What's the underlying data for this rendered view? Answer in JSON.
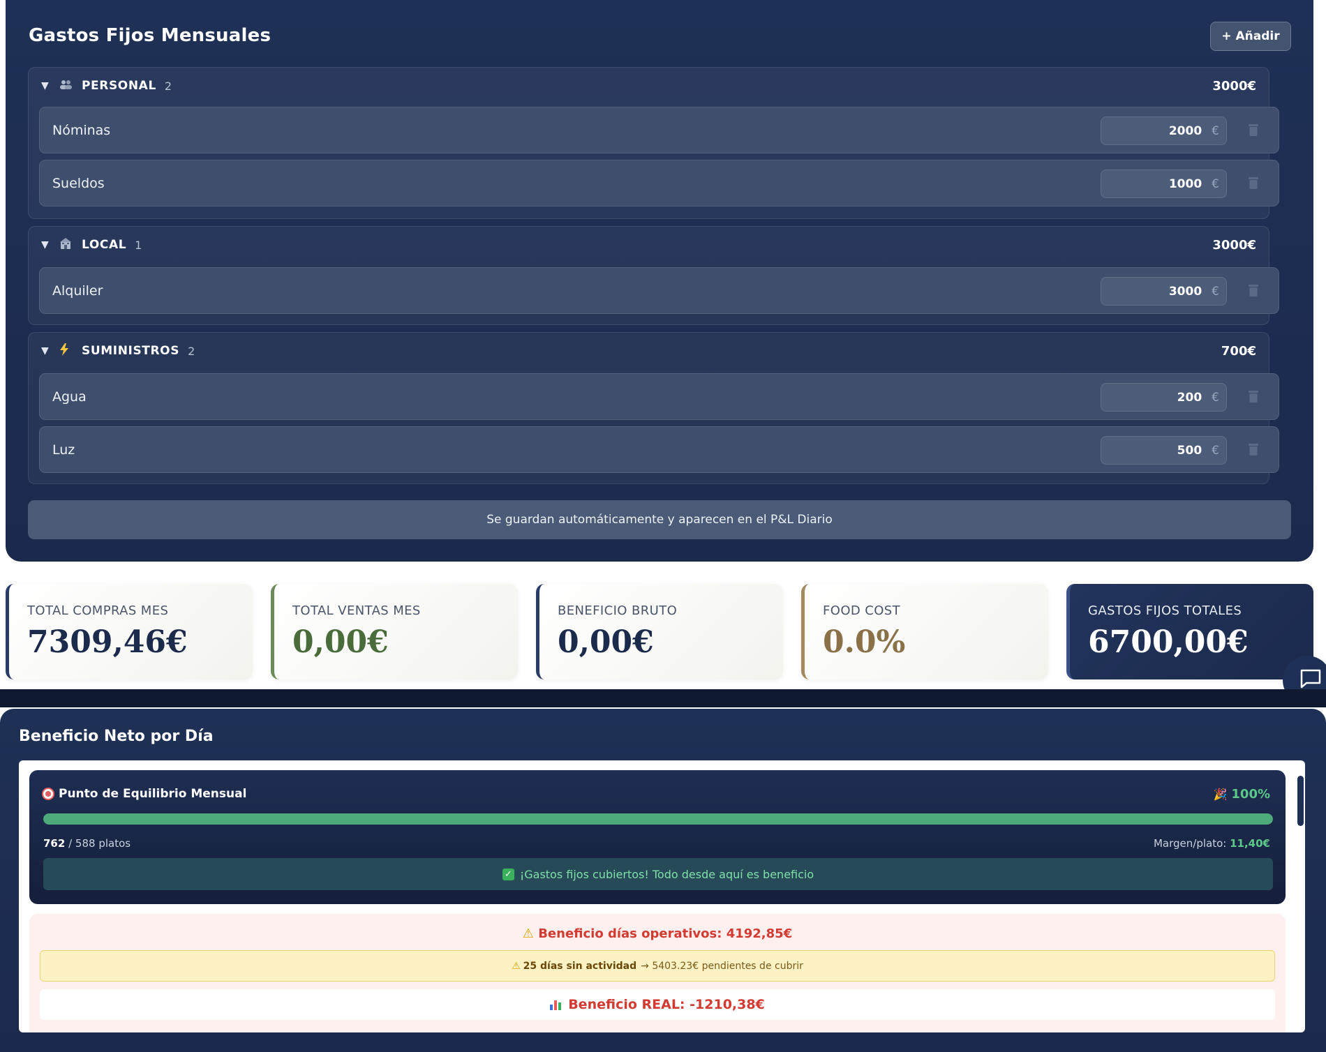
{
  "fixed_costs": {
    "title": "Gastos Fijos Mensuales",
    "add_button": "+ Añadir",
    "currency_symbol": "€",
    "categories": [
      {
        "name": "PERSONAL",
        "icon": "people-icon",
        "count": "2",
        "total": "3000€",
        "items": [
          {
            "label": "Nóminas",
            "amount": "2000"
          },
          {
            "label": "Sueldos",
            "amount": "1000"
          }
        ]
      },
      {
        "name": "LOCAL",
        "icon": "building-icon",
        "count": "1",
        "total": "3000€",
        "items": [
          {
            "label": "Alquiler",
            "amount": "3000"
          }
        ]
      },
      {
        "name": "SUMINISTROS",
        "icon": "lightning-icon",
        "count": "2",
        "total": "700€",
        "items": [
          {
            "label": "Agua",
            "amount": "200"
          },
          {
            "label": "Luz",
            "amount": "500"
          }
        ]
      }
    ],
    "note": "Se guardan automáticamente y aparecen en el P&L Diario"
  },
  "stats": [
    {
      "label": "TOTAL COMPRAS MES",
      "value": "7309,46€",
      "color": "#1c2b4c",
      "accent": "#2a3d66"
    },
    {
      "label": "TOTAL VENTAS MES",
      "value": "0,00€",
      "color": "#4a6b3a",
      "accent": "#6b8b5a"
    },
    {
      "label": "BENEFICIO BRUTO",
      "value": "0,00€",
      "color": "#1c2b4c",
      "accent": "#2a3d66"
    },
    {
      "label": "FOOD COST",
      "value": "0.0%",
      "color": "#8a7148",
      "accent": "#a48a5e"
    },
    {
      "label": "GASTOS FIJOS TOTALES",
      "value": "6700,00€",
      "color": "#ffffff",
      "accent": "#3c5287"
    }
  ],
  "net_profit": {
    "title": "Beneficio Neto por Día",
    "breakeven": {
      "title": "Punto de Equilibrio Mensual",
      "percent": "100%",
      "progress_fraction": 1.0,
      "plates_sold": "762",
      "plates_target": "/ 588 platos",
      "margin_label": "Margen/plato:",
      "margin_value": "11,40€",
      "banner": "¡Gastos fijos cubiertos! Todo desde aquí es beneficio"
    },
    "operating_days_label": "Beneficio días operativos:",
    "operating_days_value": "4192,85€",
    "inactive_days": "25 días sin actividad",
    "inactive_rest": "→ 5403.23€ pendientes de cubrir",
    "real_profit": "Beneficio REAL: -1210,38€"
  }
}
